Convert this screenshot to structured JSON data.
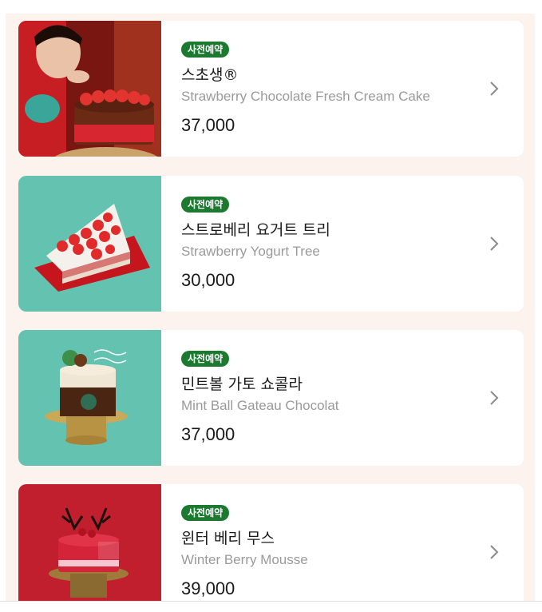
{
  "products": [
    {
      "badge": "사전예약",
      "name_ko": "스초생®",
      "name_en": "Strawberry Chocolate Fresh Cream Cake",
      "price": "37,000",
      "image": "strawberry-chocolate-cake-photo",
      "colors": {
        "bg": "#8e1a14"
      }
    },
    {
      "badge": "사전예약",
      "name_ko": "스트로베리 요거트 트리",
      "name_en": "Strawberry Yogurt Tree",
      "price": "30,000",
      "image": "strawberry-yogurt-tree-photo",
      "colors": {
        "bg": "#63c3b0"
      }
    },
    {
      "badge": "사전예약",
      "name_ko": "민트볼 가토 쇼콜라",
      "name_en": "Mint Ball Gateau Chocolat",
      "price": "37,000",
      "image": "mint-ball-gateau-photo",
      "colors": {
        "bg": "#63c3b0"
      }
    },
    {
      "badge": "사전예약",
      "name_ko": "윈터 베리 무스",
      "name_en": "Winter Berry Mousse",
      "price": "39,000",
      "image": "winter-berry-mousse-photo",
      "colors": {
        "bg": "#c21f2e"
      }
    }
  ],
  "icons": {
    "chevron": "chevron-right-icon"
  },
  "colors": {
    "badge": "#1b7a2f",
    "page_bg": "#fdf3ee"
  }
}
